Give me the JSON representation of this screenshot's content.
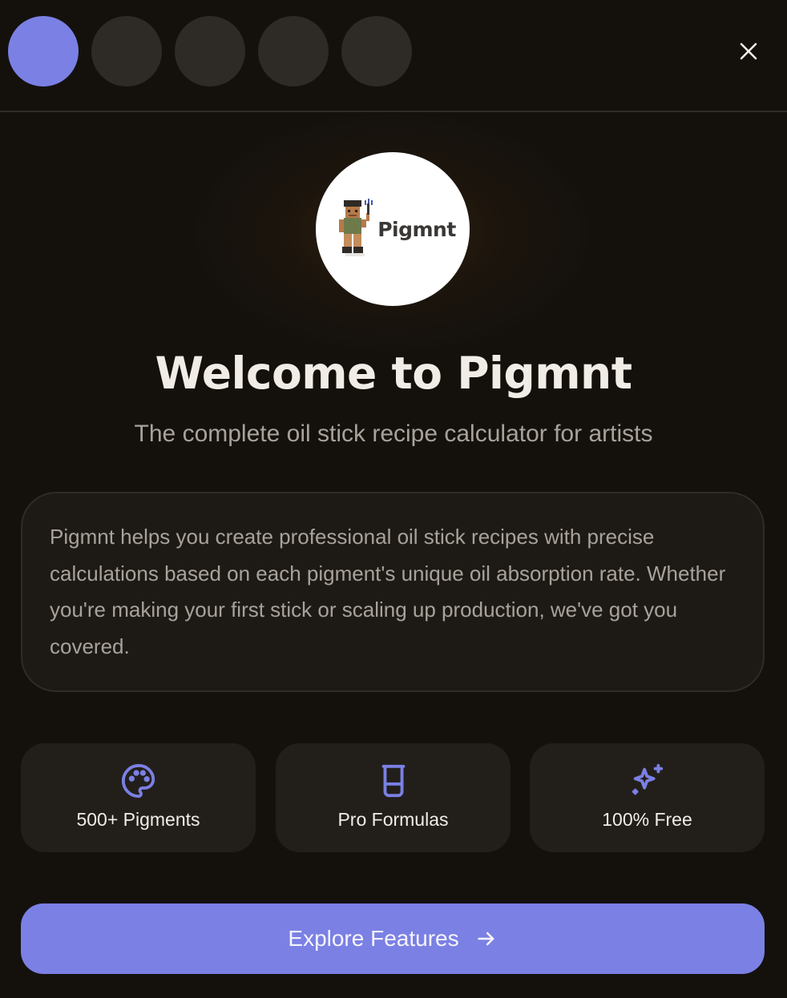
{
  "progress": {
    "total_steps": 5,
    "current_step": 1
  },
  "header": {
    "close_icon": "close-icon"
  },
  "logo": {
    "wordmark": "Pigmnt",
    "mascot_icon": "pixel-artist-mascot-icon"
  },
  "welcome": {
    "title": "Welcome to Pigmnt",
    "subtitle": "The complete oil stick recipe calculator for artists"
  },
  "description": {
    "text": "Pigmnt helps you create professional oil stick recipes with precise calculations based on each pigment's unique oil absorption rate. Whether you're making your first stick or scaling up production, we've got you covered."
  },
  "features": [
    {
      "label": "500+ Pigments",
      "icon": "palette-icon"
    },
    {
      "label": "Pro Formulas",
      "icon": "beaker-icon"
    },
    {
      "label": "100% Free",
      "icon": "sparkles-icon"
    }
  ],
  "cta": {
    "label": "Explore Features",
    "icon": "arrow-right-icon"
  },
  "colors": {
    "accent": "#7b80e4",
    "background": "#14110d",
    "card": "#1d1a16",
    "muted_text": "#a8a29a",
    "text": "#f1ede6"
  }
}
